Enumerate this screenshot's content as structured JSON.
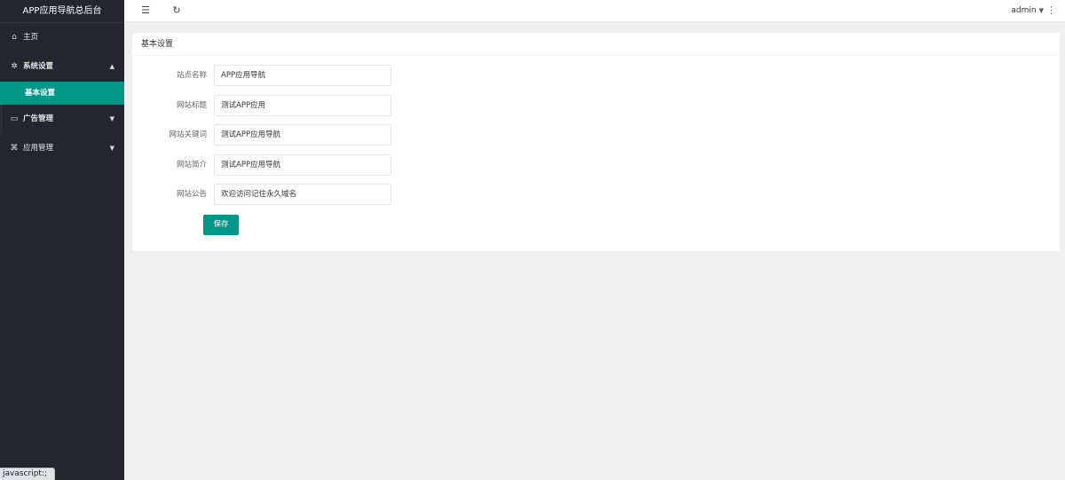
{
  "app": {
    "title": "APP应用导航总后台"
  },
  "sidebar": {
    "items": [
      {
        "label": "主页",
        "icon": "home-icon",
        "glyph": "⌂"
      },
      {
        "label": "系统设置",
        "icon": "gear-icon",
        "glyph": "✲",
        "caret": "▲",
        "expanded": true,
        "children": [
          {
            "label": "基本设置",
            "active": true
          }
        ]
      },
      {
        "label": "广告管理",
        "icon": "ad-icon",
        "glyph": "▭",
        "caret": "▼"
      },
      {
        "label": "应用管理",
        "icon": "apps-icon",
        "glyph": "⌘",
        "caret": "▼"
      }
    ]
  },
  "header": {
    "menu_toggle_glyph": "☰",
    "refresh_glyph": "↻",
    "user": "admin",
    "user_caret": "▼",
    "more_glyph": "⋮"
  },
  "card": {
    "title": "基本设置",
    "fields": [
      {
        "label": "站点名称",
        "value": "APP应用导航"
      },
      {
        "label": "网站标题",
        "value": "测试APP应用"
      },
      {
        "label": "网站关键词",
        "value": "测试APP应用导航"
      },
      {
        "label": "网站简介",
        "value": "测试APP应用导航"
      },
      {
        "label": "网站公告",
        "value": "欢迎访问记住永久域名"
      }
    ],
    "save_label": "保存"
  },
  "statusbar": {
    "text": "javascript:;"
  },
  "colors": {
    "accent": "#009688",
    "sidebar_bg": "#24262f",
    "page_bg": "#f0f0f0"
  }
}
